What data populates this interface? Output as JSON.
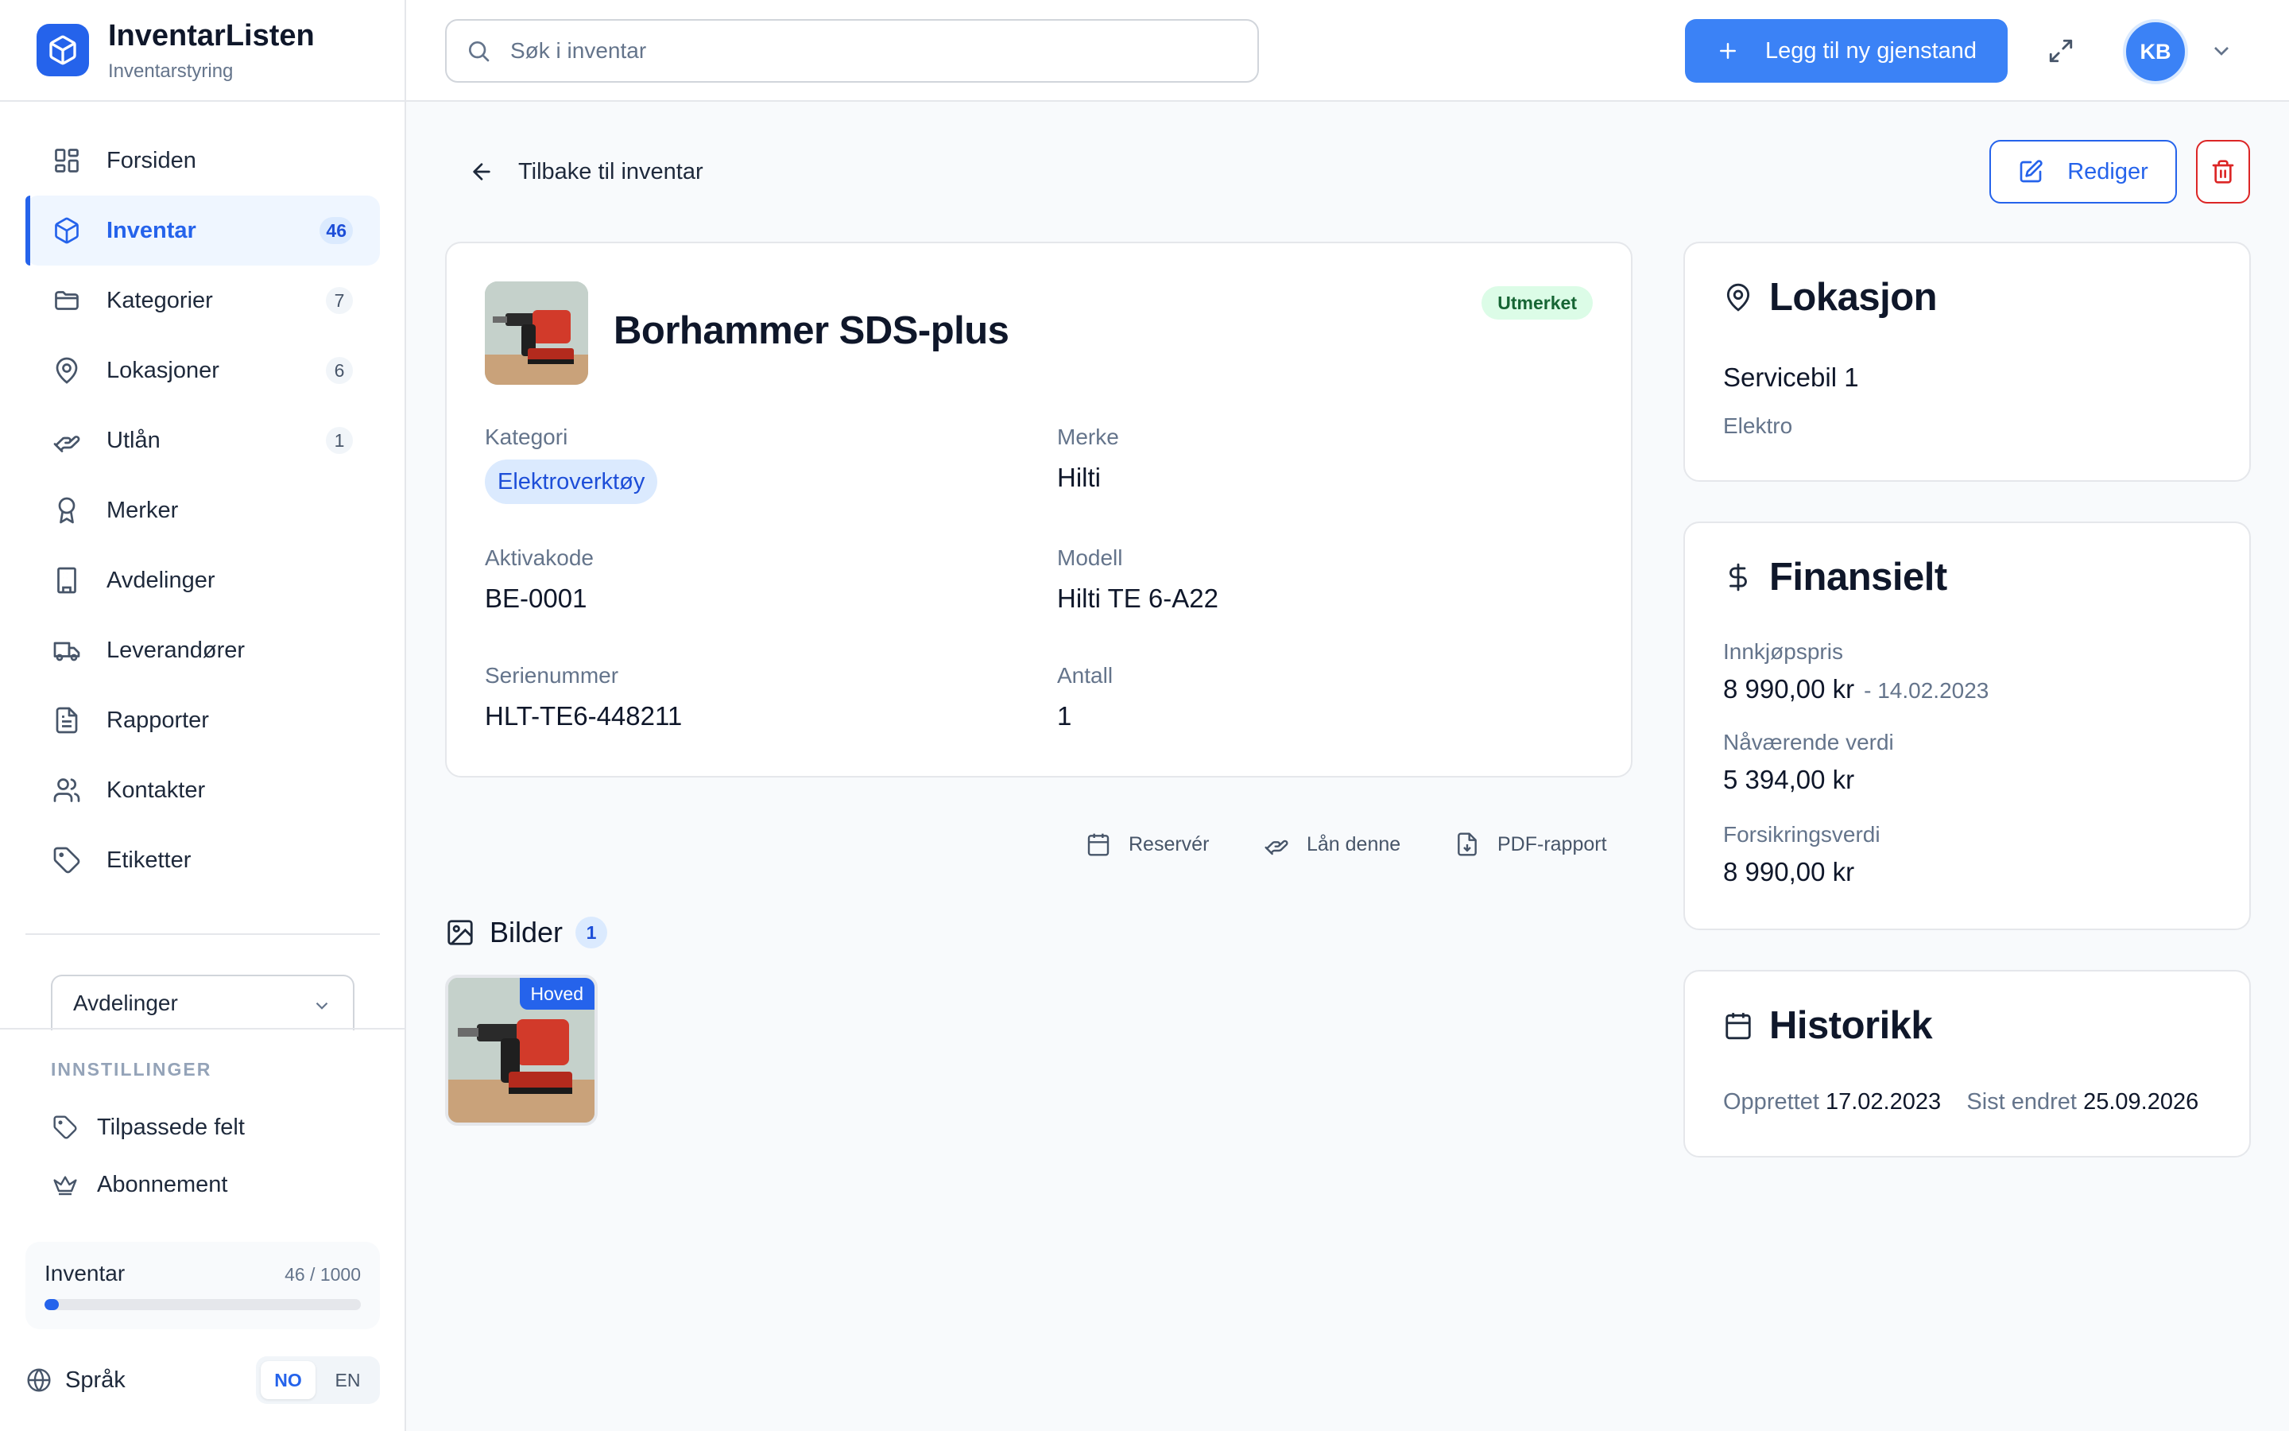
{
  "app": {
    "title": "InventarListen",
    "subtitle": "Inventarstyring"
  },
  "nav": [
    {
      "label": "Forsiden",
      "icon": "grid-icon"
    },
    {
      "label": "Inventar",
      "icon": "box-icon",
      "count": "46",
      "active": true
    },
    {
      "label": "Kategorier",
      "icon": "folder-icon",
      "count": "7"
    },
    {
      "label": "Lokasjoner",
      "icon": "map-pin-icon",
      "count": "6"
    },
    {
      "label": "Utlån",
      "icon": "hand-icon",
      "count": "1"
    },
    {
      "label": "Merker",
      "icon": "award-icon"
    },
    {
      "label": "Avdelinger",
      "icon": "building-icon"
    },
    {
      "label": "Leverandører",
      "icon": "truck-icon"
    },
    {
      "label": "Rapporter",
      "icon": "report-icon"
    },
    {
      "label": "Kontakter",
      "icon": "users-icon"
    },
    {
      "label": "Etiketter",
      "icon": "tag-icon"
    }
  ],
  "departments": {
    "selected": "Avdelinger"
  },
  "settings": {
    "title": "INNSTILLINGER",
    "items": [
      {
        "label": "Tilpassede felt",
        "icon": "tag-icon"
      },
      {
        "label": "Abonnement",
        "icon": "crown-icon"
      }
    ]
  },
  "usage": {
    "label": "Inventar",
    "value": "46 / 1000",
    "fraction": 0.046
  },
  "language": {
    "label": "Språk",
    "options": [
      "NO",
      "EN"
    ],
    "selected": "NO"
  },
  "header": {
    "search_placeholder": "Søk i inventar",
    "add_label": "Legg til ny gjenstand",
    "user_initials": "KB"
  },
  "colors": {
    "accent": "#2563eb",
    "success_bg": "#dcfce7",
    "success_text": "#166534",
    "danger": "#dc2626"
  },
  "back_label": "Tilbake til inventar",
  "edit_label": "Rediger",
  "item": {
    "name": "Borhammer SDS-plus",
    "status": "Utmerket",
    "fields": {
      "category_label": "Kategori",
      "category": "Elektroverktøy",
      "brand_label": "Merke",
      "brand": "Hilti",
      "asset_code_label": "Aktivakode",
      "asset_code": "BE-0001",
      "model_label": "Modell",
      "model": "Hilti TE 6-A22",
      "serial_label": "Serienummer",
      "serial": "HLT-TE6-448211",
      "quantity_label": "Antall",
      "quantity": "1"
    }
  },
  "actions": [
    {
      "label": "Reservér",
      "icon": "calendar-icon"
    },
    {
      "label": "Lån denne",
      "icon": "hand-icon"
    },
    {
      "label": "PDF-rapport",
      "icon": "file-download-icon"
    }
  ],
  "gallery": {
    "title": "Bilder",
    "count": "1",
    "main_badge": "Hoved"
  },
  "location": {
    "title": "Lokasjon",
    "name": "Servicebil 1",
    "sub": "Elektro"
  },
  "finance": {
    "title": "Finansielt",
    "purchase_label": "Innkjøpspris",
    "purchase_value": "8 990,00 kr",
    "purchase_date": "- 14.02.2023",
    "current_label": "Nåværende verdi",
    "current_value": "5 394,00 kr",
    "insurance_label": "Forsikringsverdi",
    "insurance_value": "8 990,00 kr"
  },
  "history": {
    "title": "Historikk",
    "created_label": "Opprettet",
    "created": "17.02.2023",
    "modified_label": "Sist endret",
    "modified": "25.09.2026"
  }
}
